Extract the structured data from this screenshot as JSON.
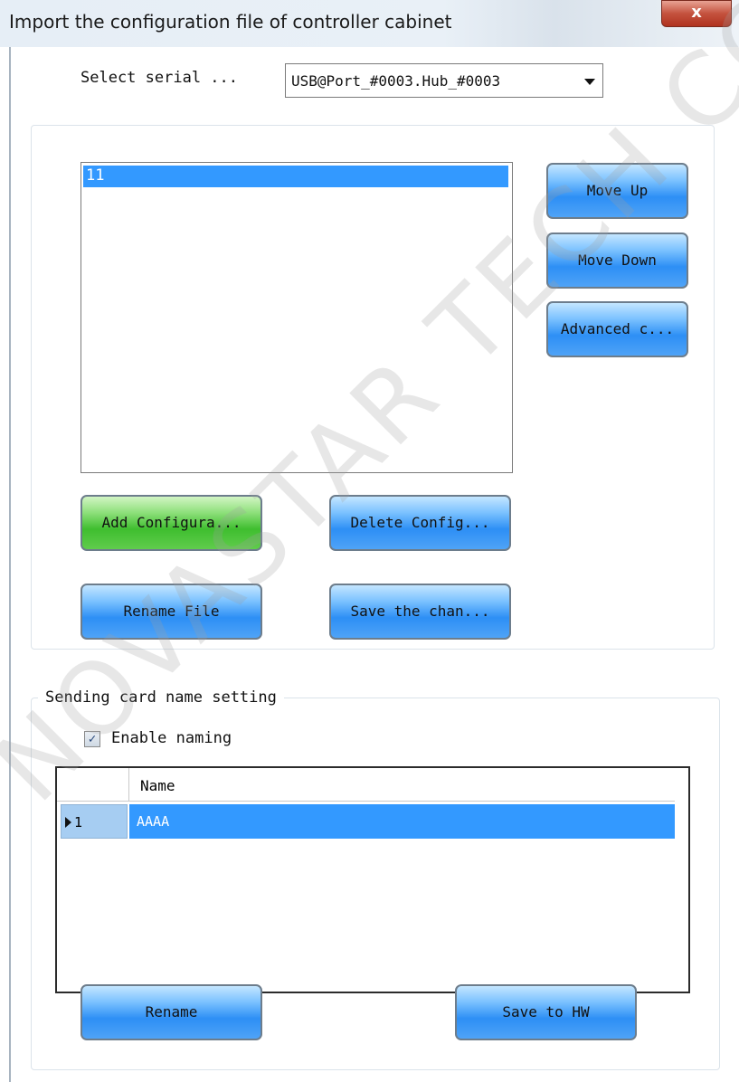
{
  "window": {
    "title": "Import the configuration file of controller cabinet",
    "close_label": "x"
  },
  "serial": {
    "label": "Select serial ...",
    "selected": "USB@Port_#0003.Hub_#0003"
  },
  "config_list": {
    "items": [
      "11"
    ]
  },
  "buttons": {
    "move_up": "Move Up",
    "move_down": "Move Down",
    "advanced": "Advanced c...",
    "add_config": "Add Configura...",
    "delete_config": "Delete Config...",
    "rename_file": "Rename File",
    "save_changes": "Save the chan...",
    "rename": "Rename",
    "save_to_hw": "Save to HW"
  },
  "sending_card": {
    "group_title": "Sending card name setting",
    "enable_naming_label": "Enable naming",
    "enable_naming_checked": true,
    "grid": {
      "header_name": "Name",
      "rows": [
        {
          "index": "1",
          "name": "AAAA"
        }
      ]
    }
  },
  "watermark": "NOVASTAR TECH CO",
  "colors": {
    "selection": "#3399ff",
    "button_blue": "#2d8ff5",
    "button_green": "#3fbe2f",
    "close_red": "#c4523e"
  }
}
